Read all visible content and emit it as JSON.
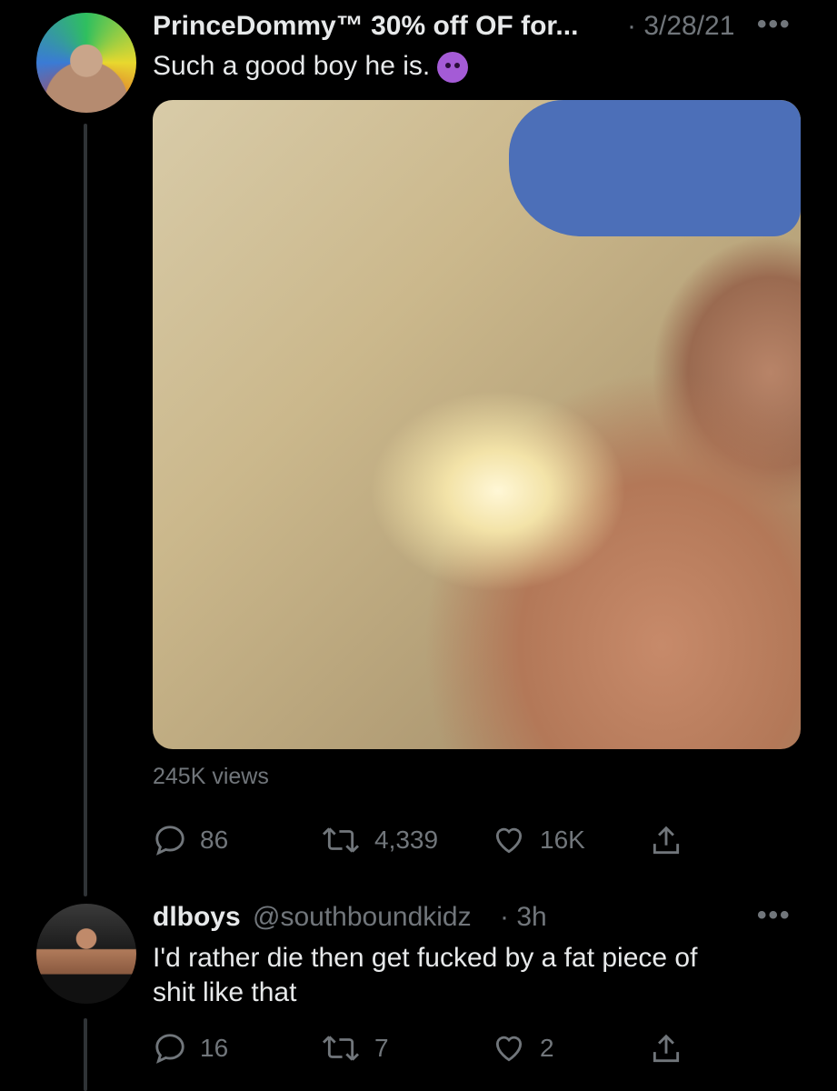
{
  "tweet": {
    "author_name": "PrinceDommy™ 30% off OF for...",
    "date": "· 3/28/21",
    "more": "•••",
    "text": "Such a good boy he is.",
    "emoji_name": "smiling-devil-emoji",
    "views": "245K views",
    "actions": {
      "replies": "86",
      "retweets": "4,339",
      "likes": "16K"
    }
  },
  "reply": {
    "author_name": "dlboys",
    "handle": "@southboundkidz",
    "time": "· 3h",
    "more": "•••",
    "text_line1": "I'd rather die then get fucked by a fat piece of",
    "text_line2": "shit like that",
    "actions": {
      "replies": "16",
      "retweets": "7",
      "likes": "2"
    }
  },
  "icons": {
    "reply": "reply-icon",
    "retweet": "retweet-icon",
    "like": "heart-icon",
    "share": "share-icon"
  },
  "colors": {
    "background": "#000000",
    "text": "#e7e9ea",
    "secondary": "#71767b"
  }
}
